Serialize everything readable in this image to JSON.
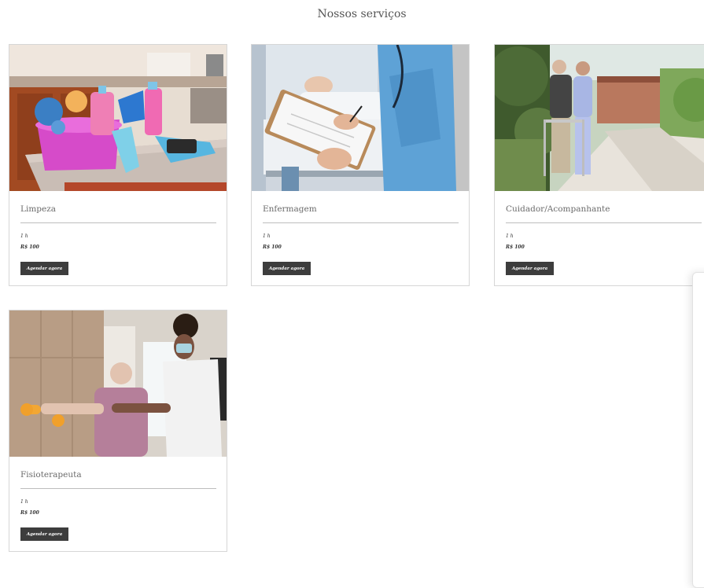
{
  "page": {
    "heading": "Nossos serviços"
  },
  "services": [
    {
      "title": "Limpeza",
      "duration": "1 h",
      "price": "R$ 100",
      "button": "Agendar agora",
      "image": "cleaning-supplies-photo"
    },
    {
      "title": "Enfermagem",
      "duration": "1 h",
      "price": "R$ 100",
      "button": "Agendar agora",
      "image": "nurse-clipboard-photo"
    },
    {
      "title": "Cuidador/Acompanhante",
      "duration": "1 h",
      "price": "R$ 100",
      "button": "Agendar agora",
      "image": "caregiver-walker-photo"
    },
    {
      "title": "Fisioterapeuta",
      "duration": "1 h",
      "price": "R$ 100",
      "button": "Agendar agora",
      "image": "physiotherapy-dumbbell-photo"
    }
  ]
}
